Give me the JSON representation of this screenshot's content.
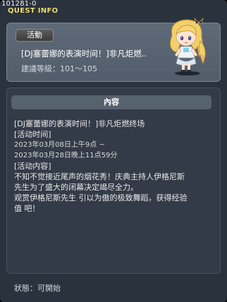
{
  "quest_id": "101281-0",
  "window_title": "QUEST INFO",
  "badge_label": "活動",
  "quest_name": "[DJ塞蕾娜的表演时间！]非凡炬燃..",
  "level_label": "建議等級：101～105",
  "section_header": "內容",
  "content_lines": [
    "[DJ塞蕾娜的表演时间！]非凡炬燃终场",
    "",
    "[活动时间]",
    "2023年03月08日上午9点 ~",
    "2023年03月28日晚上11点59分",
    "",
    "[活动内容]",
    "不知不觉接近尾声的烟花秀！庆典主持人伊格尼斯",
    "先生为了盛大的闭幕决定竭尽全力。",
    "观赏伊格尼斯先生 引以为傲的极致舞蹈，获得经验",
    "值 吧！"
  ],
  "status_label": "狀態：可開始",
  "colors": {
    "title": "#f0e07a",
    "window_bg": "#2a323d",
    "panel": "#5a6574"
  },
  "npc_icon": "npc-portrait-icon"
}
